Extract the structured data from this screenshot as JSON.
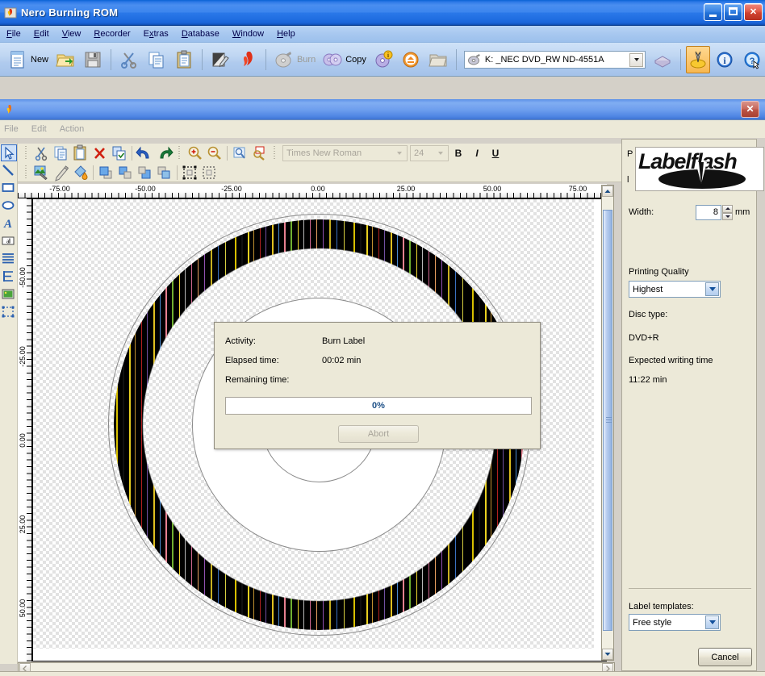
{
  "window": {
    "title": "Nero Burning ROM",
    "icon": "nero-flame-icon",
    "minimize_label": "Minimize",
    "maximize_label": "Maximize",
    "close_label": "Close"
  },
  "menubar": {
    "items": [
      {
        "label": "File",
        "accel": "F"
      },
      {
        "label": "Edit",
        "accel": "E"
      },
      {
        "label": "View",
        "accel": "V"
      },
      {
        "label": "Recorder",
        "accel": "R"
      },
      {
        "label": "Extras",
        "accel": "x"
      },
      {
        "label": "Database",
        "accel": "D"
      },
      {
        "label": "Window",
        "accel": "W"
      },
      {
        "label": "Help",
        "accel": "H"
      }
    ]
  },
  "toolbar": {
    "new_label": "New",
    "open_label": "Open",
    "save_label": "Save",
    "cut_label": "Cut",
    "copy_item_label": "Copy",
    "paste_label": "Paste",
    "edit_label": "Edit",
    "nero_express_label": "Nero Express",
    "burn_label": "Burn",
    "copy_label": "Copy",
    "info_label": "Disc Info",
    "eject_label": "Eject",
    "browse_label": "Browse",
    "drive_value": "K: _NEC DVD_RW ND-4551A",
    "drive_icon": "drive-icon",
    "medium_info_label": "Medium Info",
    "labelflash_label": "Labelflash",
    "about_label": "About",
    "help_label": "Help"
  },
  "inner_window": {
    "icon": "labelflash-flame-icon",
    "close_label": "Close",
    "menus": [
      "File",
      "Edit",
      "Action"
    ]
  },
  "editor_toolbar": {
    "row1": [
      {
        "name": "cut-icon",
        "label": "Cut"
      },
      {
        "name": "copy-icon",
        "label": "Copy"
      },
      {
        "name": "paste-icon",
        "label": "Paste"
      },
      {
        "name": "delete-icon",
        "label": "Delete"
      },
      {
        "name": "duplicate-icon",
        "label": "Duplicate"
      },
      {
        "name": "undo-icon",
        "label": "Undo"
      },
      {
        "name": "redo-icon",
        "label": "Redo"
      },
      {
        "name": "zoom-in-icon",
        "label": "Zoom In"
      },
      {
        "name": "zoom-out-icon",
        "label": "Zoom Out"
      },
      {
        "name": "zoom-fit-icon",
        "label": "Zoom Fit"
      },
      {
        "name": "zoom-region-icon",
        "label": "Zoom Region"
      }
    ],
    "row2": [
      {
        "name": "insert-image-icon",
        "label": "Insert Image"
      },
      {
        "name": "pencil-icon",
        "label": "Pencil"
      },
      {
        "name": "fill-icon",
        "label": "Fill"
      },
      {
        "name": "bring-front-icon",
        "label": "Bring To Front"
      },
      {
        "name": "bring-forward-icon",
        "label": "Bring Forward"
      },
      {
        "name": "send-backward-icon",
        "label": "Send Backward"
      },
      {
        "name": "send-back-icon",
        "label": "Send To Back"
      },
      {
        "name": "select-all-icon",
        "label": "Select All"
      },
      {
        "name": "deselect-icon",
        "label": "Deselect"
      }
    ],
    "font_name": "Times New Roman",
    "font_size": "24",
    "bold_label": "B",
    "italic_label": "I",
    "underline_label": "U"
  },
  "tool_palette": [
    {
      "name": "pointer-tool",
      "label": "Select",
      "selected": true
    },
    {
      "name": "line-tool",
      "label": "Line"
    },
    {
      "name": "rectangle-tool",
      "label": "Rectangle"
    },
    {
      "name": "ellipse-tool",
      "label": "Ellipse"
    },
    {
      "name": "text-tool",
      "label": "Text"
    },
    {
      "name": "text-field-tool",
      "label": "Text Field"
    },
    {
      "name": "text-block-tool",
      "label": "Text Block"
    },
    {
      "name": "curved-text-tool",
      "label": "Curved Text"
    },
    {
      "name": "image-tool",
      "label": "Image"
    },
    {
      "name": "marquee-tool",
      "label": "Marquee"
    }
  ],
  "rulers": {
    "horizontal": [
      "-75.00",
      "-50.00",
      "-25.00",
      "0.00",
      "25.00",
      "50.00",
      "75.00"
    ],
    "vertical": [
      "-50.00",
      "-25.00",
      "0.00",
      "25.00",
      "50.00"
    ]
  },
  "side_panel": {
    "obscured_line1": "P",
    "obscured_line2": "l",
    "logo_text": "Labelflash",
    "width_label": "Width:",
    "width_value": "8",
    "width_unit": "mm",
    "printing_quality_label": "Printing Quality",
    "printing_quality_value": "Highest",
    "disc_type_label": "Disc type:",
    "disc_type_value": "DVD+R",
    "expected_time_label": "Expected writing time",
    "expected_time_value": "11:22 min",
    "label_templates_label": "Label templates:",
    "label_templates_value": "Free style",
    "cancel_label": "Cancel"
  },
  "dialog": {
    "activity_label": "Activity:",
    "activity_value": "Burn Label",
    "elapsed_label": "Elapsed time:",
    "elapsed_value": "00:02 min",
    "remaining_label": "Remaining time:",
    "remaining_value": "",
    "progress_text": "0%",
    "progress_percent": 0,
    "abort_label": "Abort"
  },
  "colors": {
    "title_blue": "#2a78e8",
    "panel_bg": "#ece9d8",
    "progress_text": "#1c4f86",
    "accent_orange": "#f0a020"
  }
}
